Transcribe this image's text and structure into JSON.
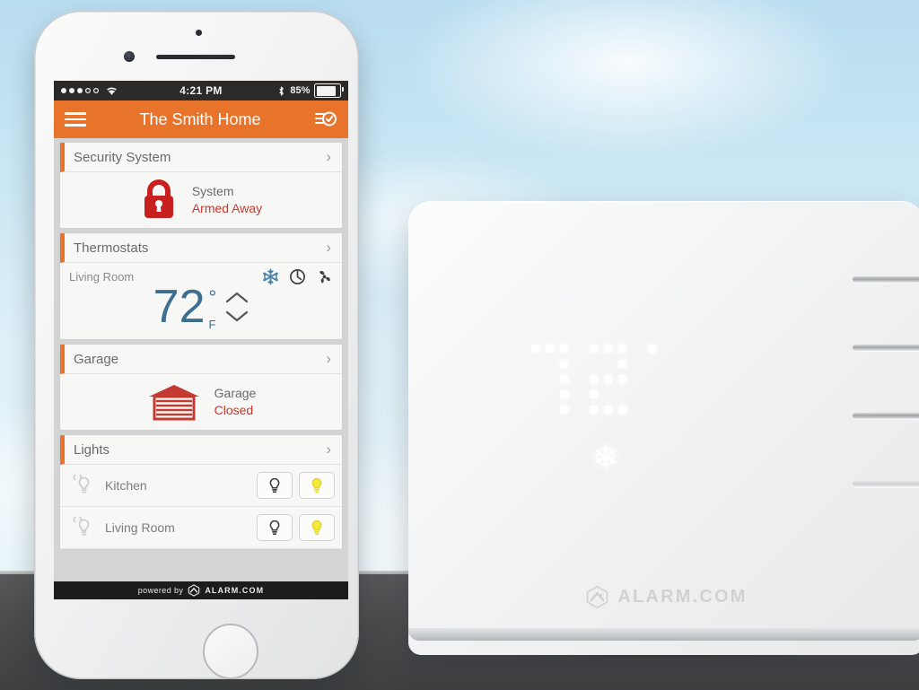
{
  "scene": {
    "background": "sky-with-clouds",
    "sky_color": "#cbe7f4",
    "ground_color": "#4a4c4e"
  },
  "phone": {
    "device": "smartphone",
    "status_bar": {
      "signal_dots_filled": 3,
      "signal_dots_empty": 2,
      "wifi_icon": "wifi-icon",
      "time": "4:21 PM",
      "bluetooth_icon": "bluetooth-icon",
      "battery_percent": "85%",
      "battery_level": 85
    },
    "navbar": {
      "menu_icon": "hamburger-menu-icon",
      "title": "The Smith Home",
      "activity_icon": "activity-checklist-icon"
    }
  },
  "app": {
    "accent_color": "#e8732a",
    "alert_color": "#c8372e",
    "thermo_color": "#3e6f8e",
    "cards": [
      {
        "id": "security",
        "header": "Security System",
        "chevron": "›",
        "icon": "lock-icon",
        "status_label": "System",
        "status_value": "Armed Away"
      },
      {
        "id": "thermostats",
        "header": "Thermostats",
        "chevron": "›",
        "zone": "Living Room",
        "mode_icons": [
          "snowflake-icon",
          "schedule-clock-icon",
          "fan-icon"
        ],
        "temperature": "72",
        "degree": "°",
        "unit": "F",
        "up_arrow": "chevron-up-icon",
        "down_arrow": "chevron-down-icon"
      },
      {
        "id": "garage",
        "header": "Garage",
        "chevron": "›",
        "icon": "garage-door-icon",
        "status_label": "Garage",
        "status_value": "Closed"
      },
      {
        "id": "lights",
        "header": "Lights",
        "chevron": "›",
        "items": [
          {
            "name": "Kitchen",
            "icon": "lightbulb-icon",
            "off_button": "bulb-off-icon",
            "on_button": "bulb-on-icon"
          },
          {
            "name": "Living Room",
            "icon": "lightbulb-icon",
            "off_button": "bulb-off-icon",
            "on_button": "bulb-on-icon"
          }
        ]
      }
    ],
    "footer": {
      "prefix": "powered by",
      "brand": "ALARM.COM",
      "logo": "alarm-com-hex-logo"
    }
  },
  "hub": {
    "device": "alarm-panel",
    "display_temperature": "72",
    "display_degree": "°",
    "display_mode_icon": "snowflake-icon",
    "brand": "ALARM.COM",
    "logo": "alarm-com-hex-logo",
    "vent_slots": 4
  }
}
